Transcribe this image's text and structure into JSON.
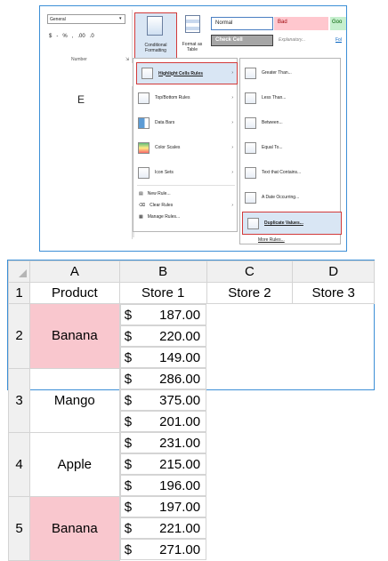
{
  "ribbon": {
    "number_format": "General",
    "number_buttons": [
      "$",
      "-",
      "%",
      ",",
      ".00",
      ".0"
    ],
    "number_group_label": "Number",
    "conditional_formatting_label": "Conditional Formatting",
    "format_as_table_label": "Format as Table",
    "style_normal": "Normal",
    "style_bad": "Bad",
    "style_good": "Goo",
    "style_check_cell": "Check Cell",
    "style_explanatory": "Explanatory...",
    "style_follow": "Fol",
    "column_letter": "E"
  },
  "menu": {
    "items": [
      {
        "label": "Highlight Cells Rules",
        "submenu": true
      },
      {
        "label": "Top/Bottom Rules",
        "submenu": true
      },
      {
        "label": "Data Bars",
        "submenu": true
      },
      {
        "label": "Color Scales",
        "submenu": true
      },
      {
        "label": "Icon Sets",
        "submenu": true
      }
    ],
    "small_items": [
      "New Rule...",
      "Clear Rules",
      "Manage Rules..."
    ]
  },
  "submenu": {
    "items": [
      "Greater Than...",
      "Less Than...",
      "Between...",
      "Equal To...",
      "Text that Contains...",
      "A Date Occurring...",
      "Duplicate Values..."
    ],
    "more": "More Rules..."
  },
  "sheet": {
    "columns": [
      "A",
      "B",
      "C",
      "D"
    ],
    "rows": [
      {
        "num": "1",
        "a": "Product",
        "b": "Store 1",
        "c": "Store 2",
        "d": "Store 3"
      },
      {
        "num": "2",
        "a": "Banana",
        "b": "187.00",
        "c": "220.00",
        "d": "149.00"
      },
      {
        "num": "3",
        "a": "Mango",
        "b": "286.00",
        "c": "375.00",
        "d": "201.00"
      },
      {
        "num": "4",
        "a": "Apple",
        "b": "231.00",
        "c": "215.00",
        "d": "196.00"
      },
      {
        "num": "5",
        "a": "Banana",
        "b": "197.00",
        "c": "221.00",
        "d": "271.00"
      }
    ],
    "currency": "$",
    "highlight_color": "#f9c7ce"
  }
}
